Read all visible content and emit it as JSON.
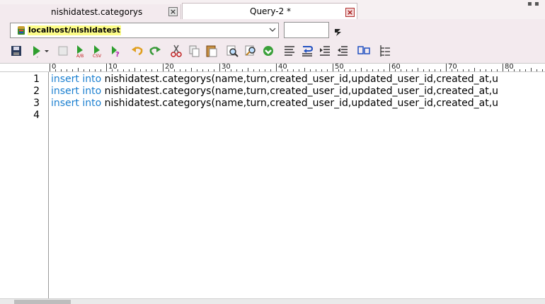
{
  "tabs": [
    {
      "label": "nishidatest.categorys",
      "active": false
    },
    {
      "label": "Query-2 *",
      "active": true
    }
  ],
  "connection": {
    "value": "localhost/nishidatest",
    "small_field_value": ""
  },
  "toolbar": {
    "icons": [
      "save-icon",
      "execute-icon",
      "stop-icon",
      "export-xml-icon",
      "export-csv-icon",
      "validate-icon",
      "undo-icon",
      "redo-icon",
      "cut-icon",
      "copy-icon",
      "paste-icon",
      "find-icon",
      "replace-icon",
      "goto-icon",
      "format-icon",
      "wrap-icon",
      "indent-icon",
      "outdent-icon",
      "block-icon",
      "tree-icon"
    ]
  },
  "ruler": {
    "labels": [
      "0",
      "10",
      "20",
      "30",
      "40",
      "50",
      "60",
      "70",
      "80"
    ]
  },
  "editor": {
    "line_numbers": [
      "1",
      "2",
      "3",
      "4"
    ],
    "lines": [
      {
        "kw1": "insert",
        "kw2": "into",
        "rest": " nishidatest.categorys(name,turn,created_user_id,updated_user_id,created_at,u"
      },
      {
        "kw1": "insert",
        "kw2": "into",
        "rest": " nishidatest.categorys(name,turn,created_user_id,updated_user_id,created_at,u"
      },
      {
        "kw1": "insert",
        "kw2": "into",
        "rest": " nishidatest.categorys(name,turn,created_user_id,updated_user_id,created_at,u"
      },
      {
        "kw1": "",
        "kw2": "",
        "rest": ""
      }
    ]
  },
  "colors": {
    "keyword": "#1a7fd0",
    "highlight": "#fcfc88",
    "chrome": "#f3eaee"
  }
}
